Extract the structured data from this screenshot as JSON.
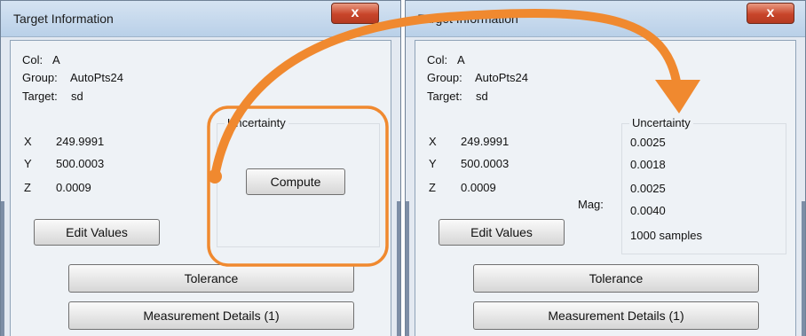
{
  "left_dialog": {
    "title": "Target Information",
    "close_glyph": "x",
    "col_label": "Col:",
    "col_value": "A",
    "group_label": "Group:",
    "group_value": "AutoPts24",
    "target_label": "Target:",
    "target_value": "sd",
    "x_label": "X",
    "x_value": "249.9991",
    "y_label": "Y",
    "y_value": "500.0003",
    "z_label": "Z",
    "z_value": "0.0009",
    "uncertainty_label": "Uncertainty",
    "compute_label": "Compute",
    "edit_values_label": "Edit Values",
    "tolerance_label": "Tolerance",
    "measurement_details_label": "Measurement Details (1)"
  },
  "right_dialog": {
    "title": "Target Information",
    "close_glyph": "x",
    "col_label": "Col:",
    "col_value": "A",
    "group_label": "Group:",
    "group_value": "AutoPts24",
    "target_label": "Target:",
    "target_value": "sd",
    "x_label": "X",
    "x_value": "249.9991",
    "y_label": "Y",
    "y_value": "500.0003",
    "z_label": "Z",
    "z_value": "0.0009",
    "mag_label": "Mag:",
    "uncertainty_label": "Uncertainty",
    "uncertainty_x": "0.0025",
    "uncertainty_y": "0.0018",
    "uncertainty_z": "0.0025",
    "uncertainty_mag": "0.0040",
    "samples": "1000 samples",
    "edit_values_label": "Edit Values",
    "tolerance_label": "Tolerance",
    "measurement_details_label": "Measurement Details (1)"
  },
  "annotation": {
    "accent_color": "#f0892f",
    "arrow_icon": "curved-arrow-icon",
    "highlight_icon": "rounded-highlight-box"
  }
}
